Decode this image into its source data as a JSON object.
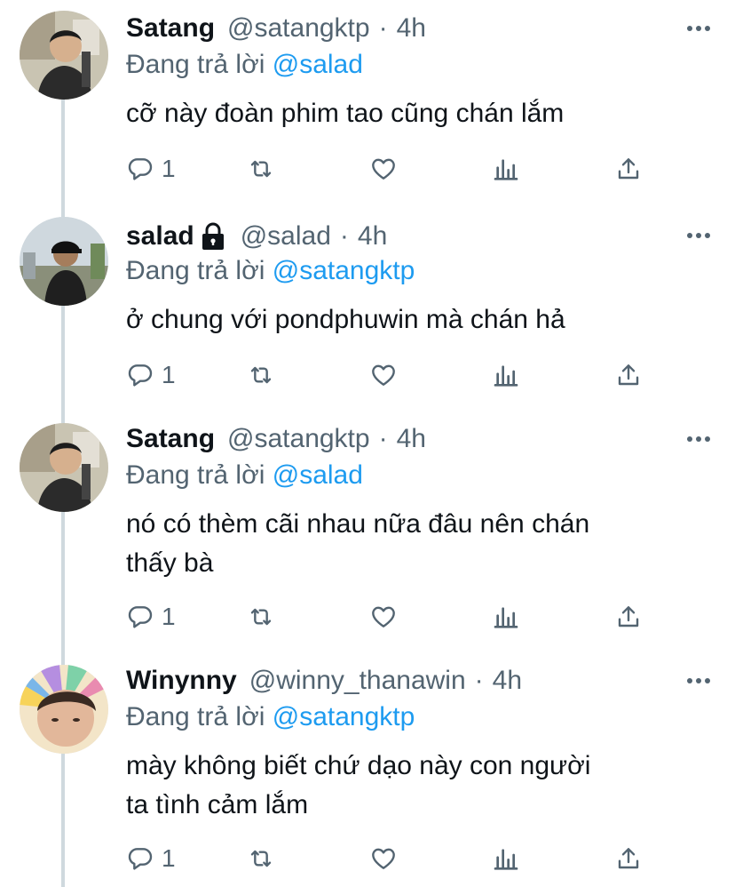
{
  "reply_prefix": "Đang trả lời",
  "tweets": [
    {
      "name": "Satang",
      "handle": "@satangktp",
      "time": "4h",
      "replying_to": "@salad",
      "text": "cỡ này đoàn phim tao cũng chán lắm",
      "reply_count": "1",
      "avatar": "satang"
    },
    {
      "name": "salad",
      "handle": "@salad",
      "time": "4h",
      "replying_to": "@satangktp",
      "text": "ở chung với pondphuwin mà chán hả",
      "reply_count": "1",
      "protected": true,
      "avatar": "salad"
    },
    {
      "name": "Satang",
      "handle": "@satangktp",
      "time": "4h",
      "replying_to": "@salad",
      "text_lines": [
        "nó có thèm cãi nhau nữa đâu nên chán",
        "thấy bà"
      ],
      "reply_count": "1",
      "avatar": "satang"
    },
    {
      "name": "Winynny",
      "handle": "@winny_thanawin",
      "time": "4h",
      "replying_to": "@satangktp",
      "text_lines": [
        "mày không biết chứ dạo này con người",
        "ta tình cảm lắm"
      ],
      "reply_count": "1",
      "avatar": "winynny"
    }
  ],
  "colors": {
    "link": "#1d9bf0",
    "secondary": "#536471",
    "thread_line": "#cfd9de"
  },
  "icons": [
    "reply-icon",
    "retweet-icon",
    "like-icon",
    "views-icon",
    "share-icon",
    "more-icon",
    "lock-icon"
  ]
}
